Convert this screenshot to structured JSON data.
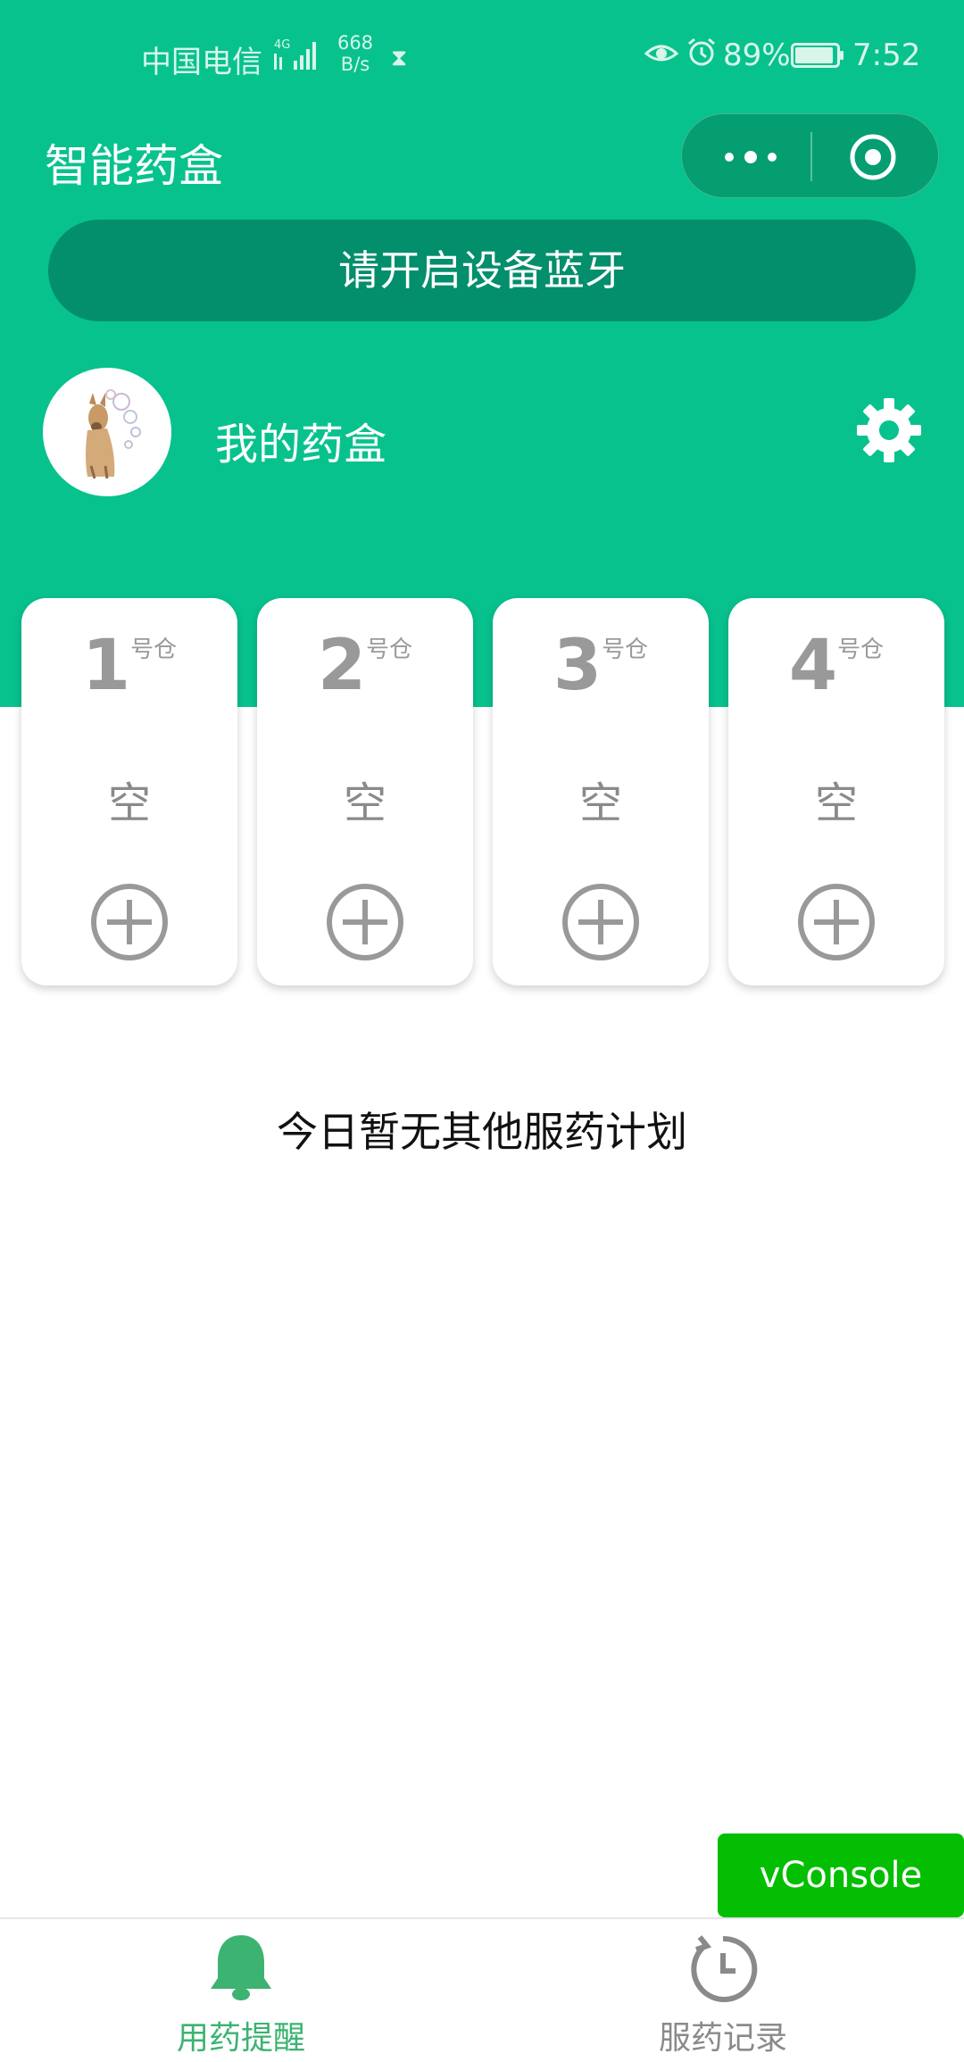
{
  "status_bar": {
    "carrier": "中国电信",
    "network": "4G",
    "speed_value": "668",
    "speed_unit": "B/s",
    "battery": "89%",
    "time": "7:52"
  },
  "header": {
    "title": "智能药盒",
    "more_icon": "more-dots-icon",
    "close_icon": "target-circle-icon"
  },
  "bluetooth_banner": "请开启设备蓝牙",
  "profile": {
    "name": "我的药盒",
    "settings_icon": "gear-icon"
  },
  "compartments": [
    {
      "number": "1",
      "suffix": "号仓",
      "status": "空"
    },
    {
      "number": "2",
      "suffix": "号仓",
      "status": "空"
    },
    {
      "number": "3",
      "suffix": "号仓",
      "status": "空"
    },
    {
      "number": "4",
      "suffix": "号仓",
      "status": "空"
    }
  ],
  "empty_message": "今日暂无其他服药计划",
  "vconsole": "vConsole",
  "tabs": [
    {
      "label": "用药提醒",
      "icon": "bell-icon",
      "active": true
    },
    {
      "label": "服药记录",
      "icon": "history-clock-icon",
      "active": false
    }
  ],
  "colors": {
    "primary": "#08c28e",
    "banner": "#038e6c",
    "active_tab": "#3cb371",
    "vconsole": "#04be02"
  }
}
